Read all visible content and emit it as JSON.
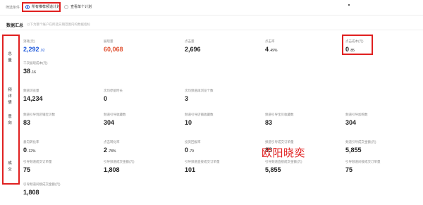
{
  "filter": {
    "label": "筛选条件",
    "option_all": "所有推荐频道计划",
    "option_single": "查看单个计划"
  },
  "section": {
    "title": "数据汇总",
    "hint": "以下为整个账户在所选日期范围内的数据指标"
  },
  "categories": [
    "总",
    "量",
    "频",
    "详",
    "情",
    "意",
    "向",
    "成",
    "交"
  ],
  "metrics": {
    "spend": {
      "label": "消耗(元)",
      "value": "2,292",
      "sub": ".02"
    },
    "impressions": {
      "label": "展现量",
      "value": "60,068"
    },
    "clicks": {
      "label": "点击量",
      "value": "2,696"
    },
    "ctr": {
      "label": "点击率",
      "value": "4",
      "sub": ".49%"
    },
    "cpc": {
      "label": "点击成本(元)",
      "value": "0",
      "sub": ".85"
    },
    "cpm": {
      "label": "千次展现成本(元)",
      "value": "38",
      "sub": ".16"
    },
    "channel_views": {
      "label": "频道浏览量",
      "value": "14,234"
    },
    "avg_stay": {
      "label": "次均停留时长",
      "value": "0"
    },
    "avg_pages": {
      "label": "次均频道再浏览个数",
      "value": "3"
    },
    "guide_shop": {
      "label": "频道引导到店铺宝贝数",
      "value": "83"
    },
    "guide_collect": {
      "label": "频道引导收藏数",
      "value": "304"
    },
    "guide_shop_collect": {
      "label": "频道引导店铺收藏数",
      "value": "10"
    },
    "guide_item_count": {
      "label": "频道引导宝贝收藏数",
      "value": "83"
    },
    "guide_cart": {
      "label": "频道引导加购数",
      "value": "304"
    },
    "intent_rate": {
      "label": "意向转化率",
      "value": "0",
      "sub": ".12%"
    },
    "click_conv": {
      "label": "点击转化率",
      "value": "2",
      "sub": ".78%"
    },
    "roi": {
      "label": "投资回报率",
      "value": "0",
      "sub": ".79"
    },
    "guide_orders": {
      "label": "频道引导成交订单量",
      "value": "83"
    },
    "guide_amount": {
      "label": "频道引导成交金额(元)",
      "value": "5,855"
    },
    "deal_count": {
      "label": "引导频道成交订单量",
      "value": "75"
    },
    "deal_amount": {
      "label": "引导频道成交金额(元)",
      "value": "1,808"
    },
    "direct_orders": {
      "label": "引导频道直接成交订单量",
      "value": "101"
    },
    "direct_amount": {
      "label": "引导频道直接成交金额(元)",
      "value": "5,855"
    },
    "indirect_orders": {
      "label": "引导频道间接成交订单量",
      "value": "75"
    },
    "indirect_amount": {
      "label": "引导频道间接成交金额(元)",
      "value": "1,808"
    }
  },
  "watermark": "欧阳晓奕"
}
